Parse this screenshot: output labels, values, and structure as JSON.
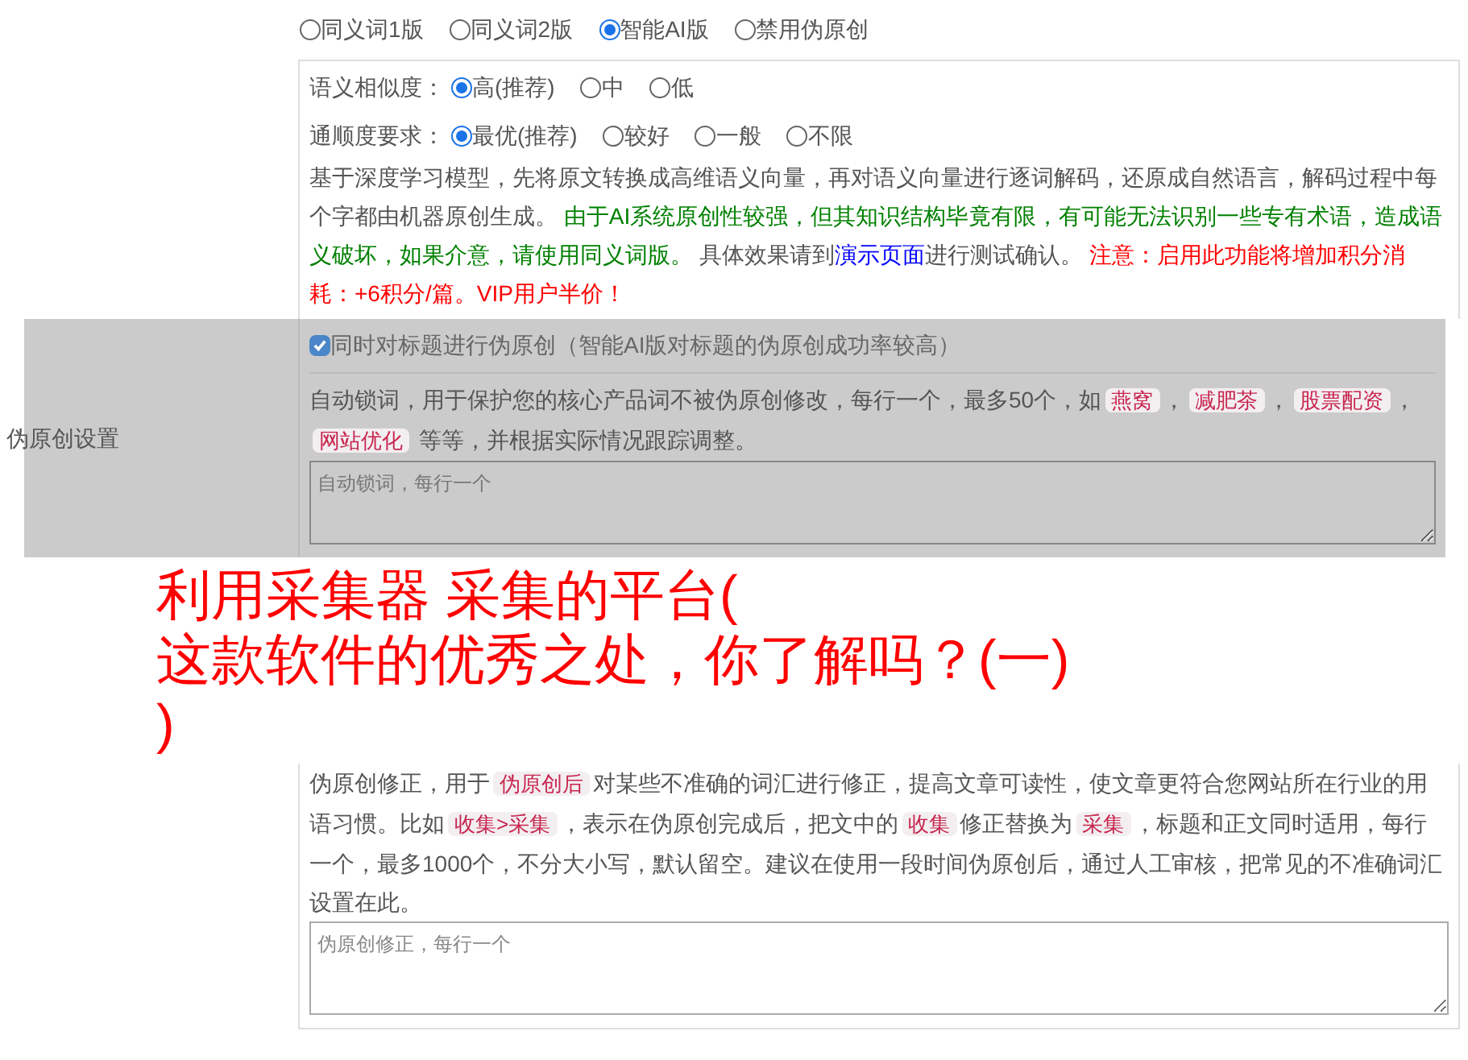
{
  "section_label": "伪原创设置",
  "modes": [
    {
      "label": "同义词1版",
      "selected": false
    },
    {
      "label": "同义词2版",
      "selected": false
    },
    {
      "label": "智能AI版",
      "selected": true
    },
    {
      "label": "禁用伪原创",
      "selected": false
    }
  ],
  "similarity": {
    "label": "语义相似度：",
    "options": [
      {
        "label": "高(推荐)",
        "selected": true
      },
      {
        "label": "中",
        "selected": false
      },
      {
        "label": "低",
        "selected": false
      }
    ]
  },
  "fluency": {
    "label": "通顺度要求：",
    "options": [
      {
        "label": "最优(推荐)",
        "selected": true
      },
      {
        "label": "较好",
        "selected": false
      },
      {
        "label": "一般",
        "selected": false
      },
      {
        "label": "不限",
        "selected": false
      }
    ]
  },
  "ai_description": [
    {
      "kind": "plain",
      "text": "基于深度学习模型，先将原文转换成高维语义向量，再对语义向量进行逐词解码，还原成自然语言，解码过程中每个字都由机器原创生成。 "
    },
    {
      "kind": "success",
      "text": "由于AI系统原创性较强，但其知识结构毕竟有限，有可能无法识别一些专有术语，造成语义破坏，如果介意，请使用同义词版。"
    },
    {
      "kind": "plain",
      "text": " 具体效果请到"
    },
    {
      "kind": "link",
      "text": "演示页面"
    },
    {
      "kind": "plain",
      "text": "进行测试确认。 "
    },
    {
      "kind": "warning",
      "text": "注意：启用此功能将增加积分消耗：+6积分/篇。VIP用户半价！"
    }
  ],
  "title_option": {
    "label": "同时对标题进行伪原创（智能AI版对标题的伪原创成功率较高）",
    "checked": true
  },
  "lock_description": [
    {
      "kind": "plain",
      "text": "自动锁词，用于保护您的核心产品词不被伪原创修改，每行一个，最多50个，如"
    },
    {
      "kind": "code",
      "text": "燕窝"
    },
    {
      "kind": "plain",
      "text": "，"
    },
    {
      "kind": "code",
      "text": "减肥茶"
    },
    {
      "kind": "plain",
      "text": "，"
    },
    {
      "kind": "code",
      "text": "股票配资"
    },
    {
      "kind": "plain",
      "text": "，"
    },
    {
      "kind": "code",
      "text": "网站优化"
    },
    {
      "kind": "plain",
      "text": " 等等，并根据实际情况跟踪调整。"
    }
  ],
  "lock_field": {
    "placeholder": "自动锁词，每行一个"
  },
  "fix_description": [
    {
      "kind": "plain",
      "text": "伪原创修正，用于"
    },
    {
      "kind": "code",
      "text": "伪原创后"
    },
    {
      "kind": "plain",
      "text": "对某些不准确的词汇进行修正，提高文章可读性，使文章更符合您网站所在行业的用语习惯。比如"
    },
    {
      "kind": "code",
      "text": "收集>采集"
    },
    {
      "kind": "plain",
      "text": "，表示在伪原创完成后，把文中的"
    },
    {
      "kind": "code",
      "text": "收集"
    },
    {
      "kind": "plain",
      "text": "修正替换为"
    },
    {
      "kind": "code",
      "text": "采集"
    },
    {
      "kind": "plain",
      "text": "，标题和正文同时适用，每行一个，最多1000个，不分大小写，默认留空。建议在使用一段时间伪原创后，通过人工审核，把常见的不准确词汇设置在此。"
    }
  ],
  "fix_field": {
    "placeholder": "伪原创修正，每行一个"
  },
  "overlay_title": [
    "利用采集器 采集的平台(",
    "这款软件的优秀之处，你了解吗？(一)",
    ")"
  ]
}
